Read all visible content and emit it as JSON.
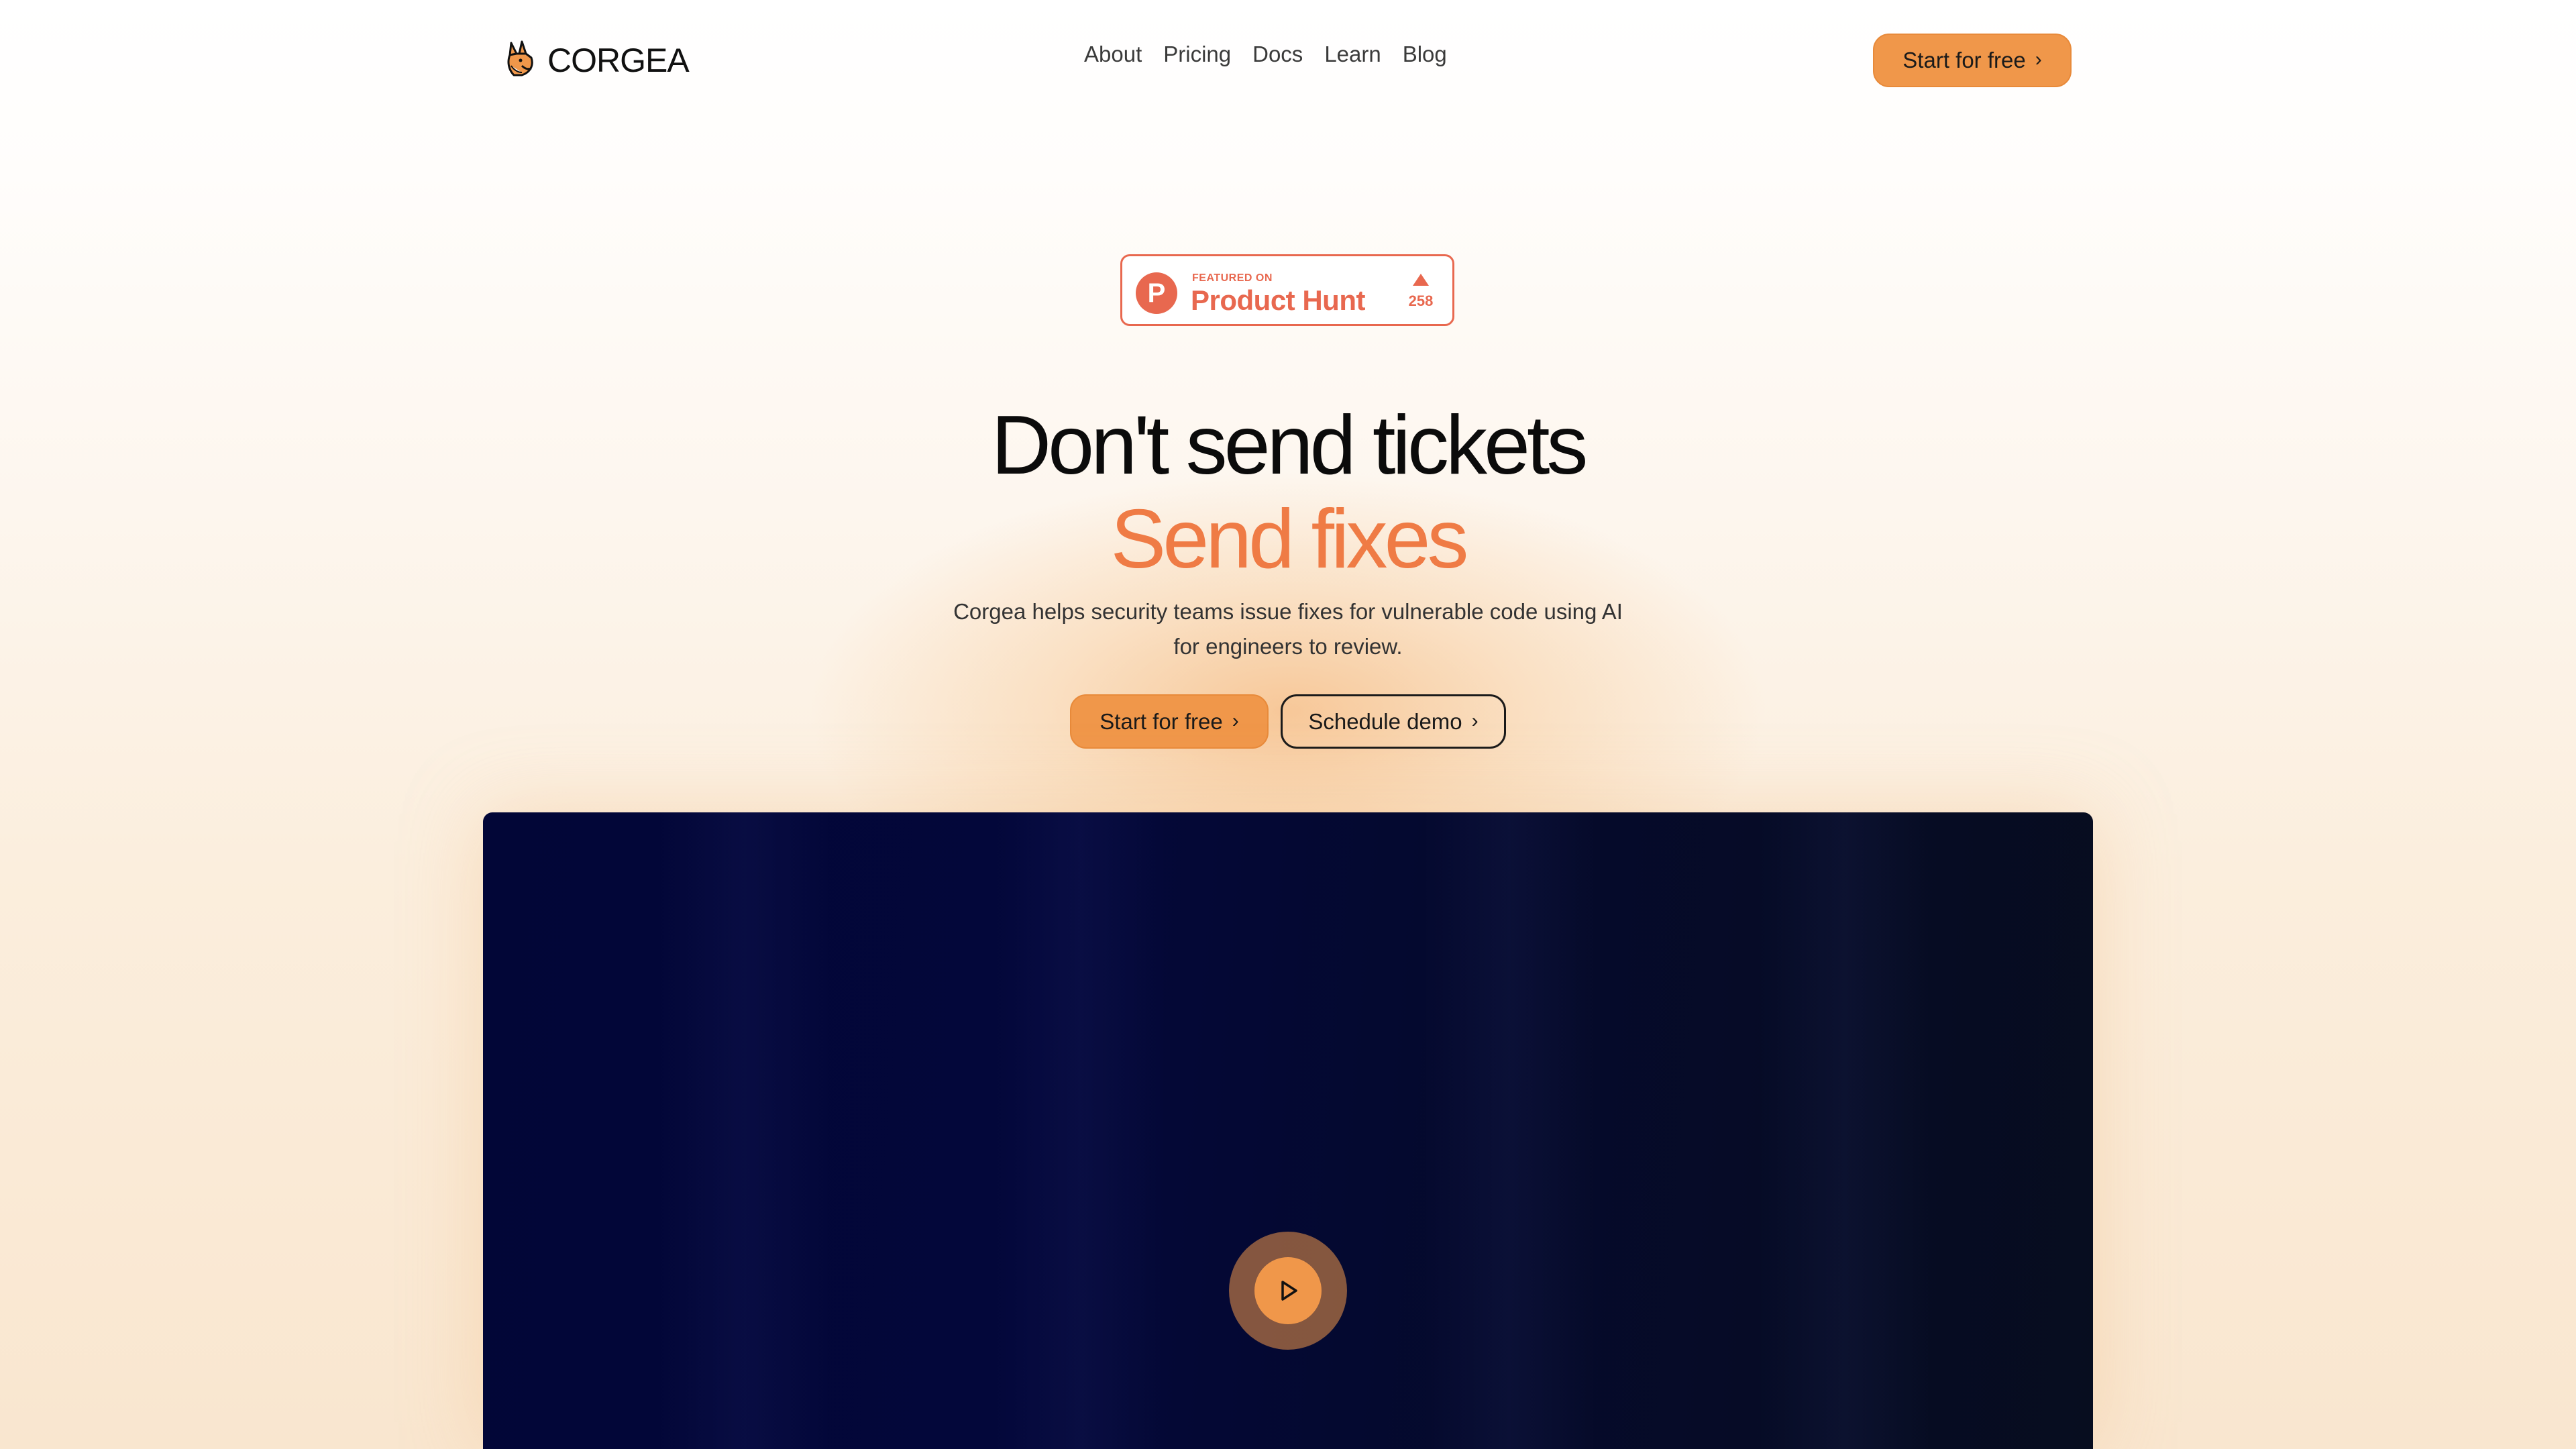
{
  "header": {
    "logo_text": "CORGEA",
    "nav": [
      "About",
      "Pricing",
      "Docs",
      "Learn",
      "Blog"
    ],
    "cta_label": "Start for free"
  },
  "badge": {
    "featured_label": "FEATURED ON",
    "name": "Product Hunt",
    "logo_letter": "P",
    "upvotes": "258"
  },
  "hero": {
    "title_line1": "Don't send tickets",
    "title_line2": "Send fixes",
    "subtitle": "Corgea helps security teams issue fixes for vulnerable code using AI for engineers to review.",
    "primary_cta": "Start for free",
    "secondary_cta": "Schedule demo"
  },
  "icons": {
    "logo": "corgi-logo-icon",
    "chevron": "chevron-right-icon",
    "upvote": "upvote-triangle-icon",
    "play": "play-icon"
  },
  "colors": {
    "accent": "#f0974a",
    "accent_text": "#ef7b45",
    "product_hunt": "#e8684f",
    "video_bg": "#02063a"
  }
}
